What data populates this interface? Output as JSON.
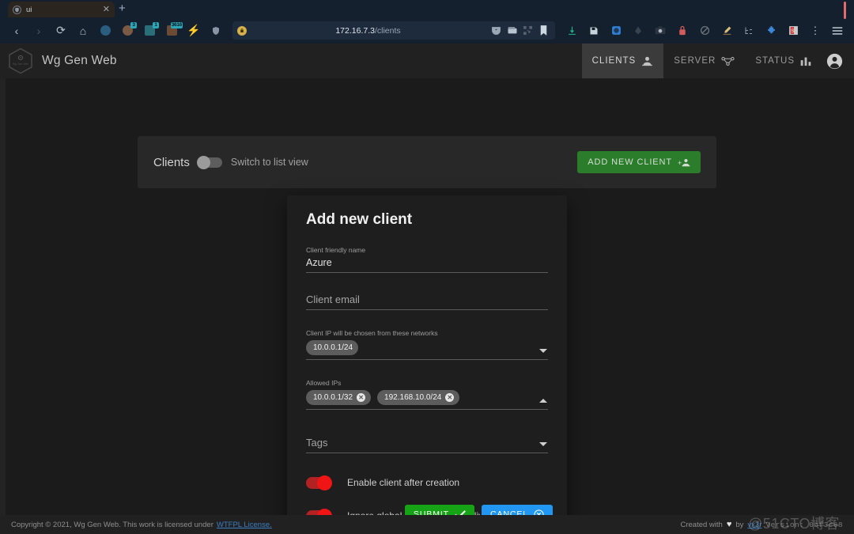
{
  "browser": {
    "tab": {
      "title": "ui",
      "favicon": "shield-icon",
      "close": "✕"
    },
    "new_tab": "+",
    "nav": {
      "back": "‹",
      "forward": "›",
      "reload": "⟳",
      "home": "⌂",
      "flash": "⚡",
      "shield": "⛨"
    },
    "extensions": [
      {
        "name": "globe-extension-icon",
        "badge": "",
        "color": "#2b5d7e"
      },
      {
        "name": "cookie-extension-icon",
        "badge": "3",
        "color": "#7a5a44"
      },
      {
        "name": "privacy-extension-icon",
        "badge": "1",
        "color": "#2a6e7a"
      },
      {
        "name": "tracker-counter-icon",
        "badge": "3616",
        "color": "#6b4b34"
      }
    ],
    "url": {
      "prefix": "172.16.7.3",
      "suffix": "/clients",
      "lock": "🔒"
    },
    "url_icons": [
      "pocket-icon",
      "wallet-icon",
      "qr-icon",
      "bookmark-icon"
    ],
    "toolbar_icons": [
      "download-icon",
      "save-icon",
      "container-icon",
      "firefox-account-icon",
      "screenshot-icon",
      "lock-manager-icon",
      "block-icon",
      "highlighter-icon",
      "tree-style-tab-icon",
      "puzzle-extension-icon",
      "stylus-icon",
      "overflow-menu-icon",
      "hamburger-menu-icon"
    ]
  },
  "app": {
    "brand": "Wg Gen Web",
    "logo_alt": "wg-gen-web-hex-logo",
    "nav": [
      {
        "label": "CLIENTS",
        "icon": "people-icon",
        "active": true
      },
      {
        "label": "SERVER",
        "icon": "network-icon",
        "active": false
      },
      {
        "label": "STATUS",
        "icon": "bar-chart-icon",
        "active": false
      }
    ],
    "account_icon": "account-circle-icon"
  },
  "clients_card": {
    "title": "Clients",
    "view_toggle_label": "Switch to list view",
    "view_toggle_on": false,
    "add_button": "ADD NEW CLIENT",
    "add_button_icon": "person-add-icon"
  },
  "modal": {
    "title": "Add new client",
    "fields": {
      "friendly_name": {
        "label": "Client friendly name",
        "value": "Azure"
      },
      "email": {
        "placeholder": "Client email",
        "value": ""
      },
      "networks": {
        "label": "Client IP will be chosen from these networks",
        "chips": [
          "10.0.0.1/24"
        ],
        "caret": "down"
      },
      "allowed_ips": {
        "label": "Allowed IPs",
        "chips": [
          "10.0.0.1/32",
          "192.168.10.0/24"
        ],
        "caret": "up"
      },
      "tags": {
        "placeholder": "Tags",
        "caret": "down"
      }
    },
    "toggles": [
      {
        "label": "Enable client after creation",
        "on": true
      },
      {
        "label": "Ignore global persistent keepalive: Yes",
        "on": true
      }
    ],
    "actions": {
      "submit": {
        "label": "SUBMIT",
        "icon": "check-icon",
        "color": "#16a316"
      },
      "cancel": {
        "label": "CANCEL",
        "icon": "close-circle-icon",
        "color": "#2196f3"
      }
    }
  },
  "footer": {
    "copyright": "Copyright © 2021, Wg Gen Web. This work is licensed under",
    "license_link": "WTFPL License.",
    "created_with": "Created with",
    "heart": "♥",
    "by": "by",
    "author": "vx3r",
    "version": "Version: 0bf3c68",
    "watermark": "@51CTO博客"
  },
  "colors": {
    "accent_green": "#2b7d2b",
    "submit_green": "#16a316",
    "cancel_blue": "#2196f3",
    "toggle_red": "#f01414",
    "link_blue": "#3b7fc4",
    "page_bg": "#1b1b1b",
    "header_bg": "#212121",
    "modal_bg": "#1e1e1e"
  }
}
